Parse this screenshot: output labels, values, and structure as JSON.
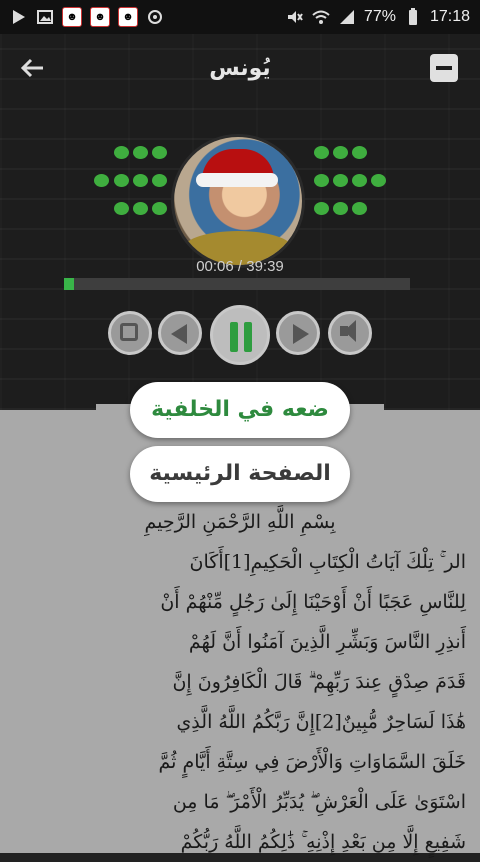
{
  "status_bar": {
    "battery": "77%",
    "time": "17:18",
    "icons": [
      "play-store-icon",
      "image-icon",
      "app-icon",
      "app-icon",
      "app-icon",
      "sync-icon",
      "mute-icon",
      "wifi-icon",
      "signal-icon",
      "battery-icon"
    ]
  },
  "app_bar": {
    "title": "يُونس",
    "back_icon": "arrow-left-icon",
    "minimize_icon": "minimize-icon"
  },
  "player": {
    "elapsed_total": "00:06 / 39:39",
    "progress_fraction": 0.0025,
    "accent_color": "#39b449",
    "controls": [
      "repeat-icon",
      "previous-icon",
      "pause-icon",
      "next-icon",
      "volume-icon"
    ]
  },
  "menu": {
    "background_label": "ضعه في الخلفية",
    "home_label": "الصفحة الرئيسية"
  },
  "text": {
    "basmala": "بِسْمِ اللَّهِ الرَّحْمَنِ الرَّحِيمِ",
    "lines": [
      "الر ۚ تِلْكَ آيَاتُ الْكِتَابِ الْحَكِيمِ[1]أَكَانَ",
      "لِلنَّاسِ عَجَبًا أَنْ أَوْحَيْنَا إِلَىٰ رَجُلٍ مِّنْهُمْ أَنْ",
      "أَنذِرِ النَّاسَ وَبَشِّرِ الَّذِينَ آمَنُوا أَنَّ لَهُمْ",
      "قَدَمَ صِدْقٍ عِندَ رَبِّهِمْ ۗ قَالَ الْكَافِرُونَ إِنَّ",
      "هَٰذَا لَسَاحِرٌ مُّبِينٌ[2]إِنَّ رَبَّكُمُ اللَّهُ الَّذِي",
      "خَلَقَ السَّمَاوَاتِ وَالْأَرْضَ فِي سِتَّةِ أَيَّامٍ ثُمَّ",
      "اسْتَوَىٰ عَلَى الْعَرْشِ ۖ يُدَبِّرُ الْأَمْرَ ۖ مَا مِن",
      "شَفِيعٍ إِلَّا مِن بَعْدِ إِذْنِهِ ۚ ذَٰلِكُمُ اللَّهُ رَبُّكُمْ"
    ]
  }
}
